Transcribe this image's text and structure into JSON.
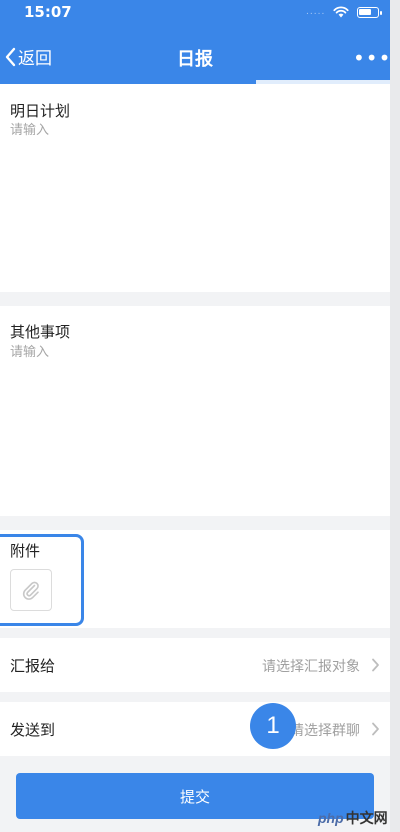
{
  "status_bar": {
    "time": "15:07",
    "signal_dots": "....."
  },
  "nav": {
    "back_label": "返回",
    "title": "日报",
    "more_label": "•••"
  },
  "plan": {
    "label": "明日计划",
    "placeholder": "请输入"
  },
  "other": {
    "label": "其他事项",
    "placeholder": "请输入"
  },
  "attachment": {
    "label": "附件"
  },
  "report_to": {
    "label": "汇报给",
    "value": "请选择汇报对象"
  },
  "send_to": {
    "label": "发送到",
    "value": "请选择群聊"
  },
  "badge": {
    "number": "1"
  },
  "submit": {
    "label": "提交"
  },
  "watermark": {
    "logo": "php",
    "text": "中文网"
  },
  "colors": {
    "accent": "#3a86e8",
    "background": "#f2f3f5",
    "placeholder": "#a6a6a6"
  }
}
